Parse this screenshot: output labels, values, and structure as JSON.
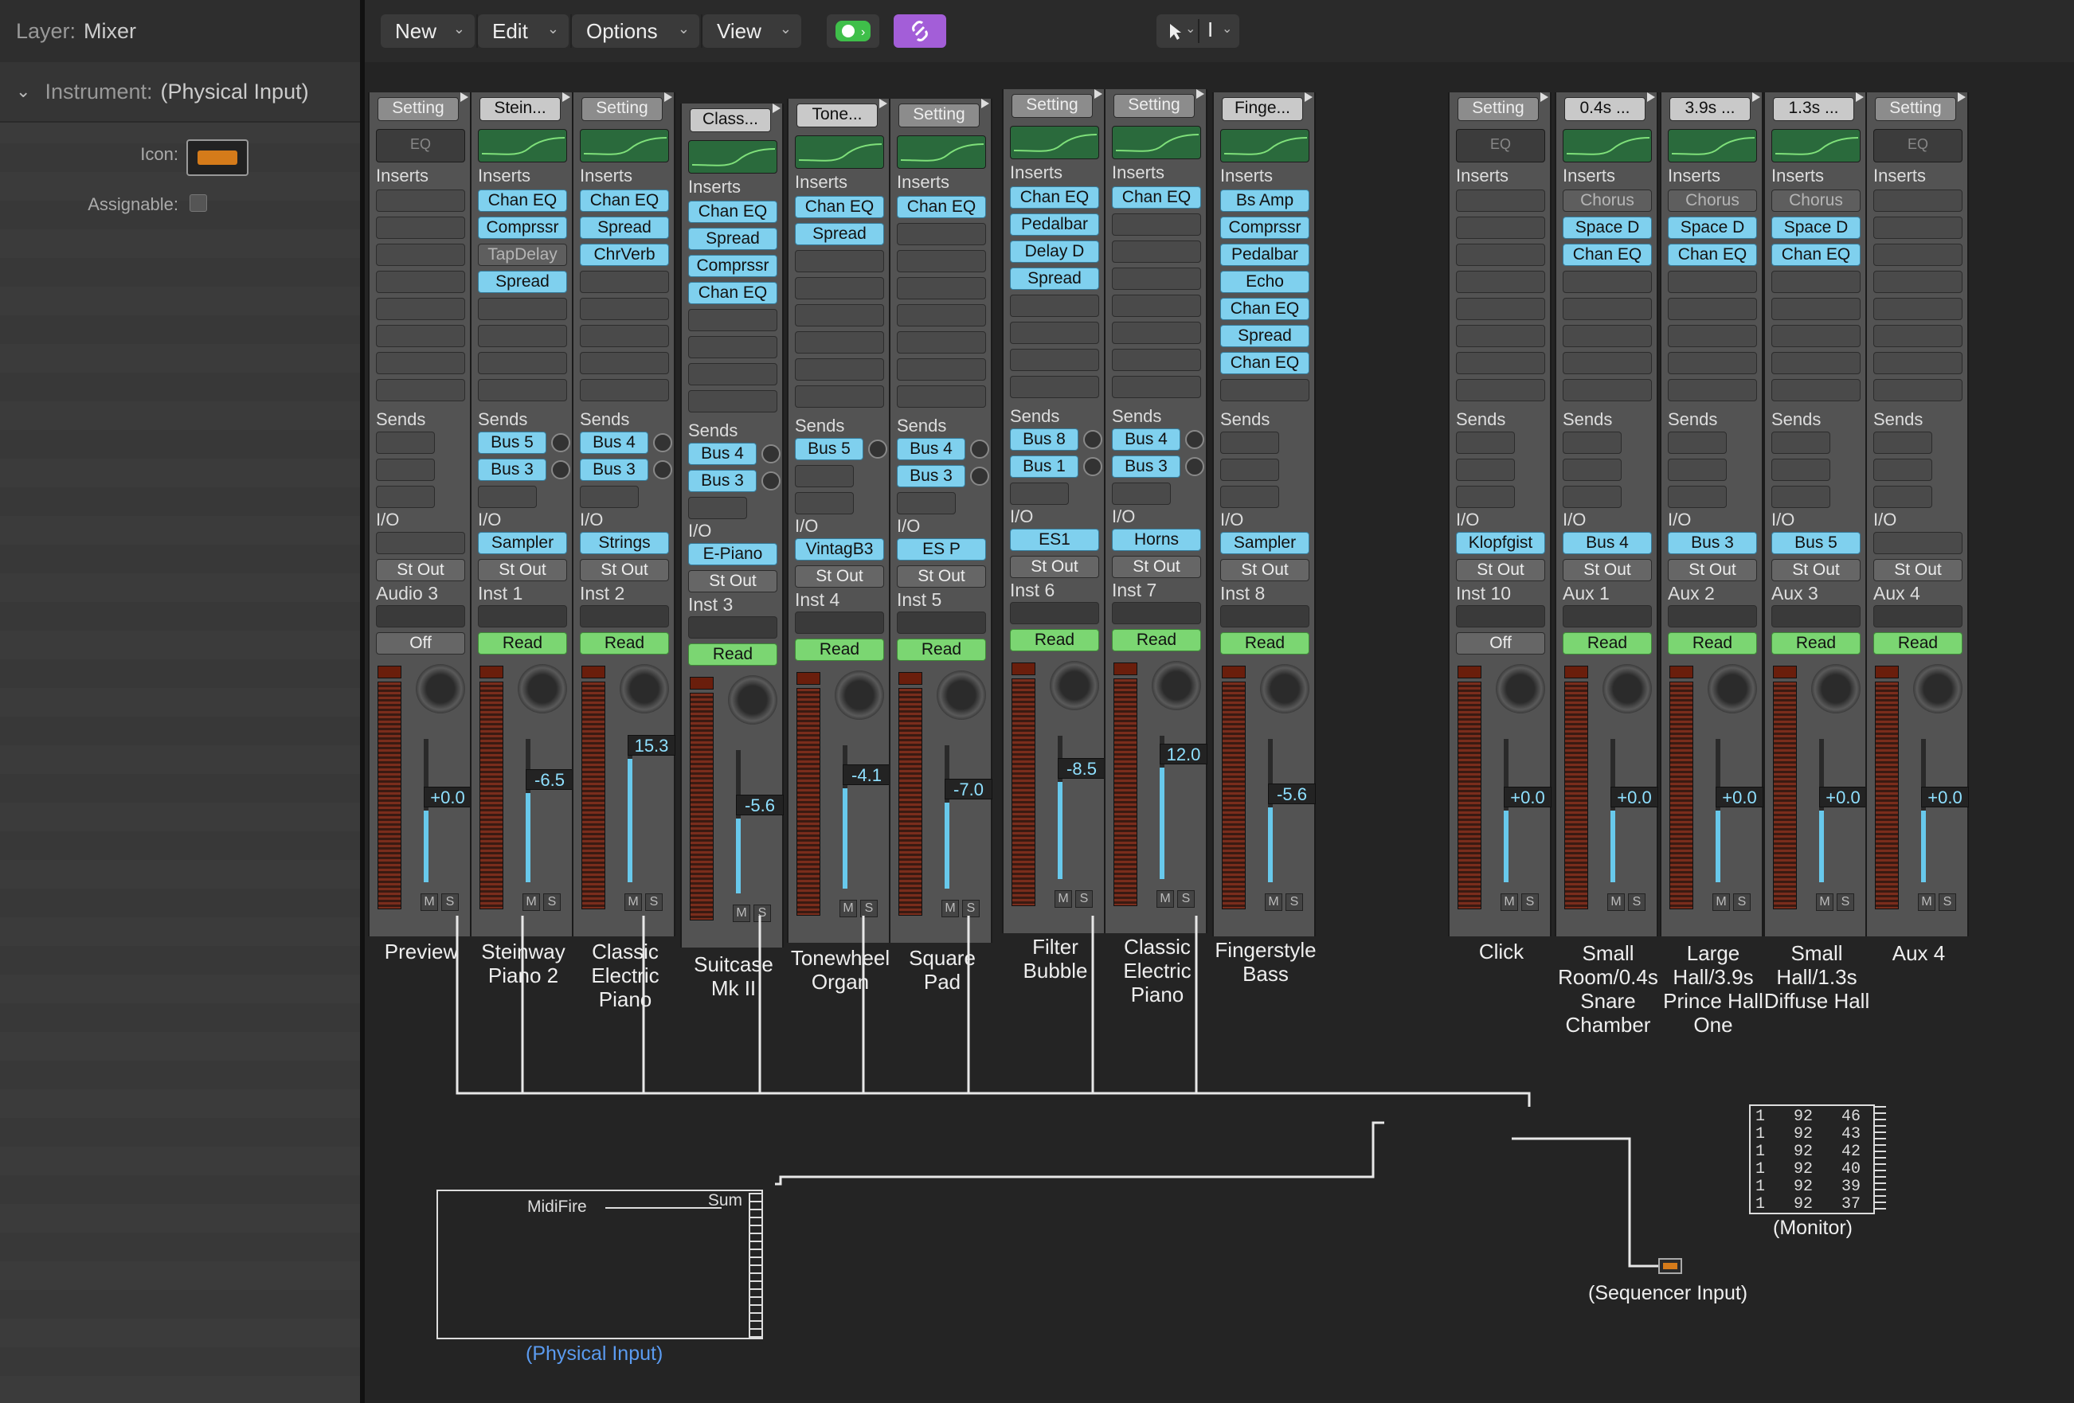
{
  "inspector": {
    "layer_label": "Layer:",
    "layer_value": "Mixer",
    "instrument_label": "Instrument:",
    "instrument_value": "(Physical Input)",
    "icon_label": "Icon:",
    "assignable_label": "Assignable:"
  },
  "toolbar": {
    "new": "New",
    "edit": "Edit",
    "options": "Options",
    "view": "View"
  },
  "section_labels": {
    "eq": "EQ",
    "inserts": "Inserts",
    "sends": "Sends",
    "io": "I/O"
  },
  "strips": [
    {
      "setting": "Setting",
      "eq": "EQ",
      "inserts": [],
      "sends": [],
      "input": "",
      "output": "St Out",
      "ch": "Audio 3",
      "auto": "Off",
      "gain": "+0.0",
      "name": "Preview"
    },
    {
      "setting": "Stein...",
      "inserts": [
        "Chan EQ",
        "Comprssr",
        "TapDelay",
        "Spread"
      ],
      "sends": [
        "Bus 5",
        "Bus 3"
      ],
      "input": "Sampler",
      "output": "St Out",
      "ch": "Inst 1",
      "auto": "Read",
      "gain": "-6.5",
      "name": "Steinway Piano 2"
    },
    {
      "setting": "Setting",
      "inserts": [
        "Chan EQ",
        "Spread",
        "ChrVerb"
      ],
      "sends": [
        "Bus 4",
        "Bus 3"
      ],
      "input": "Strings",
      "output": "St Out",
      "ch": "Inst 2",
      "auto": "Read",
      "gain": "15.3",
      "name": "Classic Electric Piano"
    },
    {
      "setting": "Class...",
      "inserts": [
        "Chan EQ",
        "Spread",
        "Comprssr",
        "Chan EQ"
      ],
      "sends": [
        "Bus 4",
        "Bus 3"
      ],
      "input": "E-Piano",
      "output": "St Out",
      "ch": "Inst 3",
      "auto": "Read",
      "gain": "-5.6",
      "name": "Suitcase Mk II"
    },
    {
      "setting": "Tone...",
      "inserts": [
        "Chan EQ",
        "Spread"
      ],
      "sends": [
        "Bus 5"
      ],
      "input": "VintagB3",
      "output": "St Out",
      "ch": "Inst 4",
      "auto": "Read",
      "gain": "-4.1",
      "name": "Tonewheel Organ"
    },
    {
      "setting": "Setting",
      "inserts": [
        "Chan EQ"
      ],
      "sends": [
        "Bus 4",
        "Bus 3"
      ],
      "input": "ES P",
      "output": "St Out",
      "ch": "Inst 5",
      "auto": "Read",
      "gain": "-7.0",
      "name": "Square Pad"
    },
    {
      "setting": "Setting",
      "inserts": [
        "Chan EQ",
        "Pedalbar",
        "Delay D",
        "Spread"
      ],
      "sends": [
        "Bus 8",
        "Bus 1"
      ],
      "input": "ES1",
      "output": "St Out",
      "ch": "Inst 6",
      "auto": "Read",
      "gain": "-8.5",
      "name": "Filter Bubble"
    },
    {
      "setting": "Setting",
      "inserts": [
        "Chan EQ"
      ],
      "sends": [
        "Bus 4",
        "Bus 3"
      ],
      "input": "Horns",
      "output": "St Out",
      "ch": "Inst 7",
      "auto": "Read",
      "gain": "12.0",
      "name": "Classic Electric Piano"
    },
    {
      "setting": "Finge...",
      "inserts": [
        "Bs Amp",
        "Comprssr",
        "Pedalbar",
        "Echo",
        "Chan EQ",
        "Spread",
        "Chan EQ"
      ],
      "sends": [],
      "input": "Sampler",
      "output": "St Out",
      "ch": "Inst 8",
      "auto": "Read",
      "gain": "-5.6",
      "name": "Fingerstyle Bass"
    },
    {
      "setting": "Setting",
      "eq": "EQ",
      "inserts": [],
      "sends": [],
      "input": "Klopfgist",
      "output": "St Out",
      "ch": "Inst 10",
      "auto": "Off",
      "gain": "+0.0",
      "name": "Click"
    },
    {
      "setting": "0.4s ...",
      "inserts": [
        "Chorus",
        "Space D",
        "Chan EQ"
      ],
      "sends": [],
      "input": "Bus 4",
      "output": "St Out",
      "ch": "Aux 1",
      "auto": "Read",
      "gain": "+0.0",
      "name": "Small Room/0.4s Snare Chamber"
    },
    {
      "setting": "3.9s ...",
      "inserts": [
        "Chorus",
        "Space D",
        "Chan EQ"
      ],
      "sends": [],
      "input": "Bus 3",
      "output": "St Out",
      "ch": "Aux 2",
      "auto": "Read",
      "gain": "+0.0",
      "name": "Large Hall/3.9s Prince Hall One"
    },
    {
      "setting": "1.3s ...",
      "inserts": [
        "Chorus",
        "Space D",
        "Chan EQ"
      ],
      "sends": [],
      "input": "Bus 5",
      "output": "St Out",
      "ch": "Aux 3",
      "auto": "Read",
      "gain": "+0.0",
      "name": "Small Hall/1.3s Diffuse Hall"
    },
    {
      "setting": "Setting",
      "eq": "EQ",
      "inserts": [],
      "sends": [],
      "input": "",
      "output": "St Out",
      "ch": "Aux 4",
      "auto": "Read",
      "gain": "+0.0",
      "name": "Aux 4"
    }
  ],
  "environment": {
    "midifire_label": "MidiFire",
    "sum_label": "Sum",
    "physical_input_label": "(Physical Input)",
    "monitor_label": "(Monitor)",
    "sequencer_input_label": "(Sequencer Input)",
    "monitor_rows": [
      "1   92   46",
      "1   92   43",
      "1   92   42",
      "1   92   40",
      "1   92   39",
      "1   92   37"
    ]
  },
  "colors": {
    "insert_active": "#7fd0ee",
    "read_green": "#7bd672",
    "link_purple": "#b066e8",
    "palette_green": "#3fbf4a",
    "physical_input_blue": "#5b9bf0"
  }
}
